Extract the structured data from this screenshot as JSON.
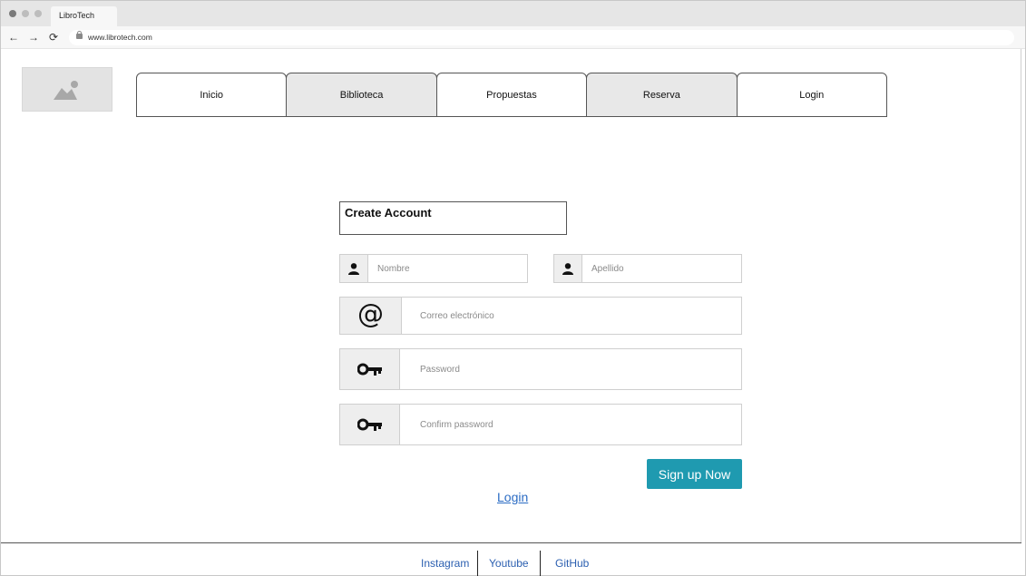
{
  "browser": {
    "tab_title": "LibroTech",
    "url": "www.librotech.com",
    "back_icon": "←",
    "forward_icon": "→",
    "reload_icon": "⟳"
  },
  "nav": {
    "items": [
      {
        "label": "Inicio"
      },
      {
        "label": "Biblioteca"
      },
      {
        "label": "Propuestas"
      },
      {
        "label": "Reserva"
      },
      {
        "label": "Login"
      }
    ]
  },
  "form": {
    "title": "Create Account",
    "first_name_placeholder": "Nombre",
    "last_name_placeholder": "Apellido",
    "email_placeholder": "Correo electrónico",
    "email_icon": "@",
    "password_placeholder": "Password",
    "confirm_password_placeholder": "Confirm password",
    "submit_label": "Sign up Now",
    "login_link": "Login"
  },
  "footer": {
    "links": [
      {
        "label": "Instagram"
      },
      {
        "label": "Youtube"
      },
      {
        "label": "GitHub"
      }
    ]
  },
  "colors": {
    "accent": "#1f9ab0",
    "link": "#2b6cc4"
  }
}
